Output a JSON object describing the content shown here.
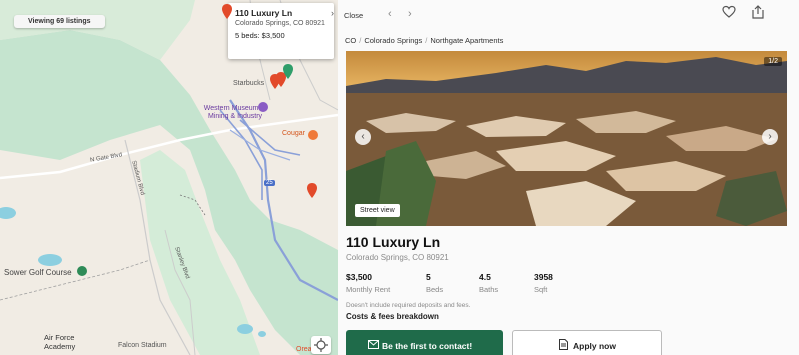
{
  "map": {
    "viewing_label": "Viewing 69 listings",
    "labels": {
      "starbucks": "Starbucks",
      "museum": "Western Museum of Mining & Industry",
      "cougar": "Cougar",
      "golf": "Sower Golf Course",
      "air_force": "Air Force Academy",
      "stadium": "Falcon Stadium",
      "interstate": "25",
      "road1": "N Gate Blvd",
      "road2": "Stadium Blvd",
      "road3": "Stanley Blvd",
      "attribution": "Orea"
    },
    "popup": {
      "title": "110 Luxury Ln",
      "address": "Colorado Springs, CO 80921",
      "beds_price": "5 beds: $3,500"
    }
  },
  "topbar": {
    "close_label": "Close",
    "prev_icon": "chevron-left-icon",
    "next_icon": "chevron-right-icon",
    "favorite_icon": "heart-icon",
    "share_icon": "share-icon"
  },
  "breadcrumb": [
    "CO",
    "Colorado Springs",
    "Northgate Apartments"
  ],
  "photo": {
    "counter": "1/2",
    "street_view_label": "Street view"
  },
  "listing": {
    "title": "110 Luxury Ln",
    "address": "Colorado Springs, CO 80921",
    "stats": [
      {
        "value": "$3,500",
        "label": "Monthly Rent"
      },
      {
        "value": "5",
        "label": "Beds"
      },
      {
        "value": "4.5",
        "label": "Baths"
      },
      {
        "value": "3958",
        "label": "Sqft"
      }
    ],
    "disclaimer": "Doesn't include required deposits and fees.",
    "fees_link": "Costs & fees breakdown"
  },
  "actions": {
    "contact_label": "Be the first to contact!",
    "apply_label": "Apply now"
  },
  "colors": {
    "accent_green": "#1f6b4a",
    "map_green": "#c5e4cf",
    "pin_red": "#e24a2a"
  }
}
